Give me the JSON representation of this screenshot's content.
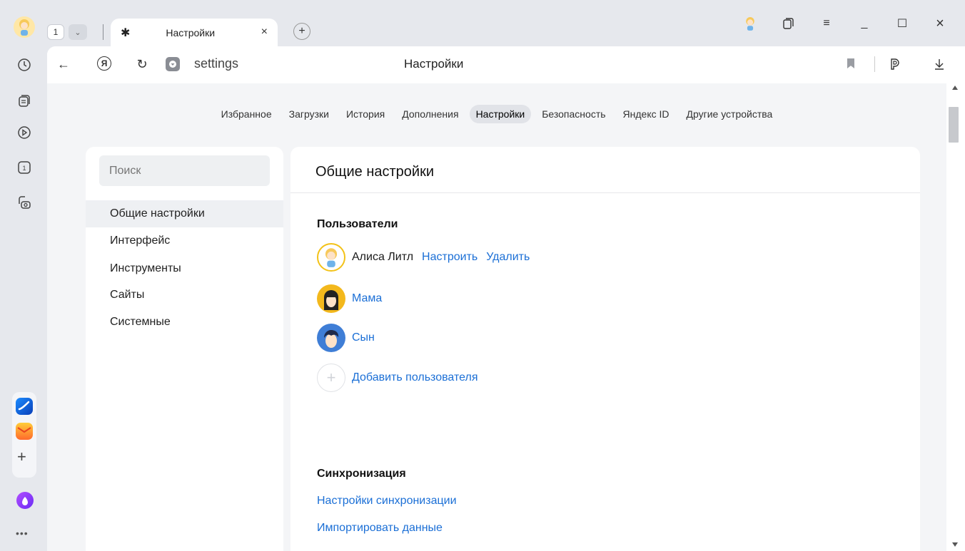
{
  "sidebar": {
    "icons": [
      "history-icon",
      "collections-icon",
      "video-icon",
      "tab-count-icon",
      "screenshot-icon"
    ],
    "tab_count_badge": "1",
    "apps": [
      "yandex-browser-app-icon",
      "mail-app-icon"
    ],
    "add_label": "+",
    "more_label": "•••"
  },
  "tabs": {
    "counter": "1",
    "active_tab_title": "Настройки",
    "close_label": "×",
    "new_tab_label": "+"
  },
  "window_controls": {
    "minimize": "_",
    "maximize": "☐",
    "close": "×",
    "menu": "≡"
  },
  "addressbar": {
    "url": "settings",
    "page_title": "Настройки"
  },
  "settings_nav": {
    "items": [
      "Избранное",
      "Загрузки",
      "История",
      "Дополнения",
      "Настройки",
      "Безопасность",
      "Яндекс ID",
      "Другие устройства"
    ],
    "active_index": 4
  },
  "left_menu": {
    "search_placeholder": "Поиск",
    "items": [
      "Общие настройки",
      "Интерфейс",
      "Инструменты",
      "Сайты",
      "Системные"
    ],
    "active_index": 0
  },
  "main": {
    "title": "Общие настройки",
    "users_section": {
      "title": "Пользователи",
      "current_user": {
        "name": "Алиса Литл",
        "configure_label": "Настроить",
        "delete_label": "Удалить"
      },
      "other_users": [
        "Мама",
        "Сын"
      ],
      "add_user_label": "Добавить пользователя"
    },
    "sync_section": {
      "title": "Синхронизация",
      "settings_link": "Настройки синхронизации",
      "import_link": "Импортировать данные"
    }
  },
  "colors": {
    "link": "#1b6fd6",
    "background": "#f4f5f7",
    "chrome": "#e6e8ed"
  }
}
